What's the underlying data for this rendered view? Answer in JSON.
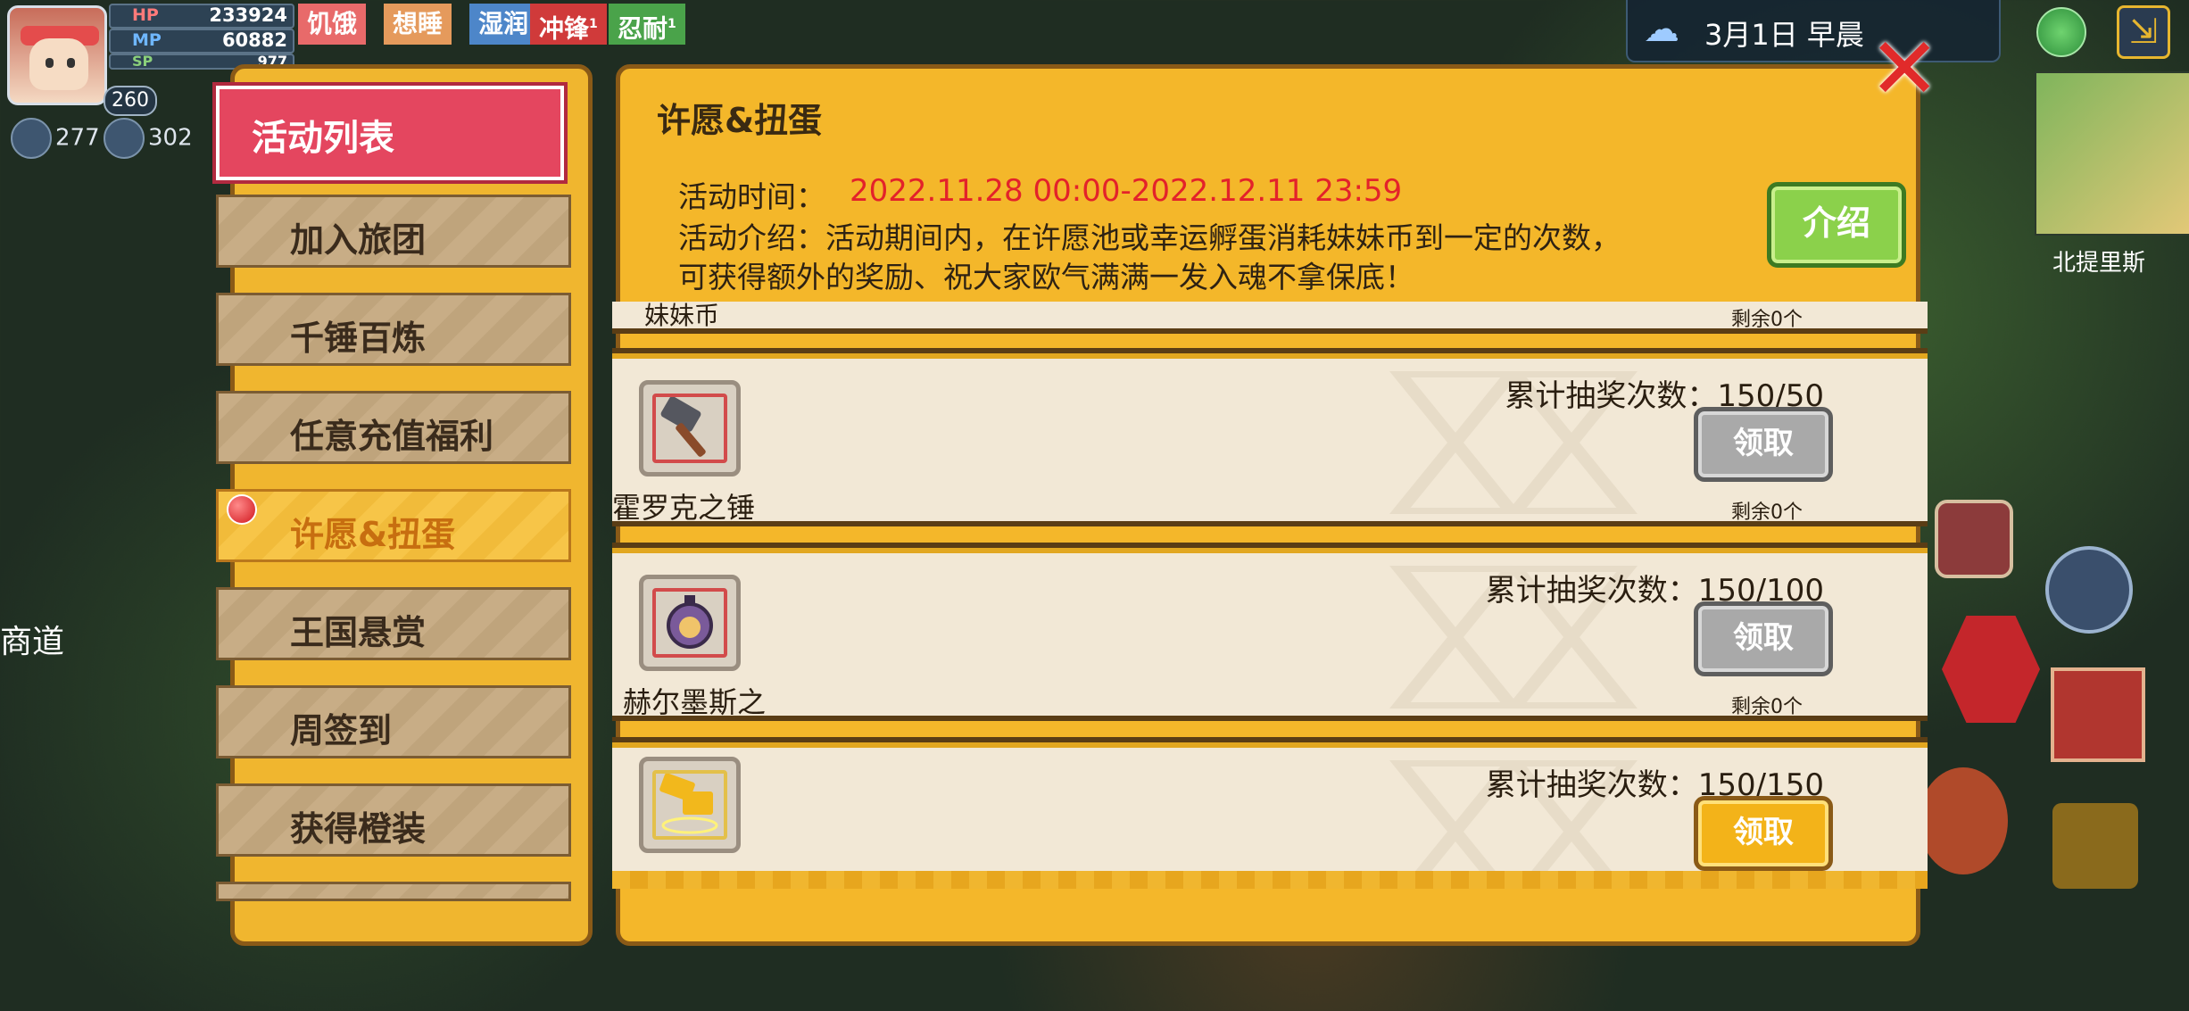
{
  "hud": {
    "level": "260",
    "hp_label": "HP",
    "hp_value": "233924",
    "mp_label": "MP",
    "mp_value": "60882",
    "sp_label": "SP",
    "sp_value": "977",
    "status_tags": [
      {
        "label": "饥饿",
        "sup": "",
        "color": "#e86a6a"
      },
      {
        "label": "想睡",
        "sup": "",
        "color": "#e59a5c"
      },
      {
        "label": "湿润",
        "sup": "",
        "color": "#4d86c9"
      },
      {
        "label": "冲锋",
        "sup": "1",
        "color": "#d03a3a"
      },
      {
        "label": "忍耐",
        "sup": "1",
        "color": "#4aa34a"
      }
    ],
    "currency_1": "277",
    "currency_2": "302",
    "weather_icon": "cloud-rain-icon",
    "date": "3月1日  早晨",
    "map_label": "北提里斯",
    "left_label": "商道"
  },
  "menu": {
    "title": "活动列表",
    "items": [
      {
        "label": "加入旅团"
      },
      {
        "label": "千锤百炼"
      },
      {
        "label": "任意充值福利"
      },
      {
        "label": "许愿&扭蛋"
      },
      {
        "label": "王国悬赏"
      },
      {
        "label": "周签到"
      },
      {
        "label": "获得橙装"
      }
    ],
    "active_index": 3
  },
  "panel": {
    "title": "许愿&扭蛋",
    "time_label": "活动时间：",
    "time_value": "2022.11.28 00:00-2022.12.11 23:59",
    "intro_line1": "活动介绍：活动期间内，在许愿池或幸运孵蛋消耗妹妹币到一定的次数，",
    "intro_line2": "可获得额外的奖励、祝大家欧气满满一发入魂不拿保底！",
    "intro_button": "介绍",
    "close_icon": "close-x-icon"
  },
  "rewards": {
    "partial_name": "妹妹币",
    "partial_remain": "剩余0个",
    "rows": [
      {
        "name": "霍罗克之锤",
        "count": "累计抽奖次数：150/50",
        "button": "领取",
        "remain": "剩余0个",
        "icon": "hammer-icon",
        "claimable": false
      },
      {
        "name": "赫尔墨斯之",
        "count": "累计抽奖次数：150/100",
        "button": "领取",
        "remain": "剩余0个",
        "icon": "potion-icon",
        "claimable": false
      },
      {
        "name": "",
        "count": "累计抽奖次数：150/150",
        "button": "领取",
        "remain": "",
        "icon": "golden-hammer-icon",
        "claimable": true
      }
    ]
  }
}
